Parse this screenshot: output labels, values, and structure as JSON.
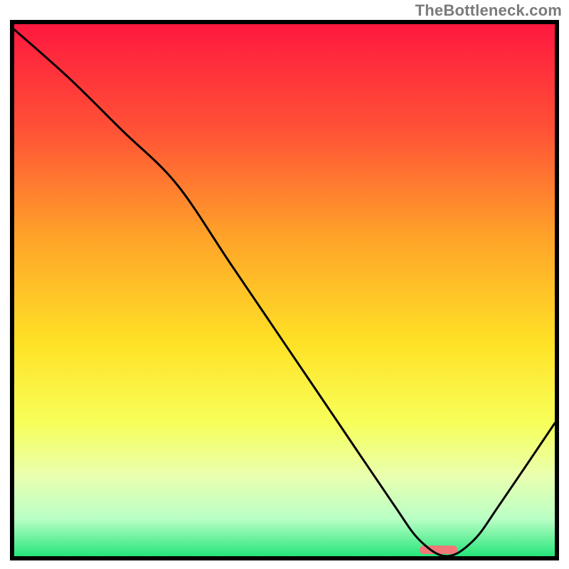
{
  "watermark": "TheBottleneck.com",
  "chart_data": {
    "type": "line",
    "title": "",
    "xlabel": "",
    "ylabel": "",
    "xlim": [
      0,
      100
    ],
    "ylim": [
      0,
      100
    ],
    "series": [
      {
        "name": "curve",
        "x": [
          0,
          10,
          20,
          30,
          40,
          50,
          60,
          70,
          75,
          80,
          85,
          90,
          100
        ],
        "values": [
          99,
          90,
          80,
          70,
          55,
          40,
          25,
          10,
          3,
          0,
          3,
          10,
          25
        ]
      }
    ],
    "marker": {
      "x_start": 75,
      "x_end": 82,
      "y": 1.2,
      "color": "#f07878"
    },
    "gradient_stops": [
      {
        "offset": 0.0,
        "color": "#ff183f"
      },
      {
        "offset": 0.2,
        "color": "#ff5236"
      },
      {
        "offset": 0.4,
        "color": "#ffa329"
      },
      {
        "offset": 0.6,
        "color": "#ffe226"
      },
      {
        "offset": 0.75,
        "color": "#f7ff5a"
      },
      {
        "offset": 0.85,
        "color": "#e9ffb0"
      },
      {
        "offset": 0.93,
        "color": "#b9ffc5"
      },
      {
        "offset": 1.0,
        "color": "#26e57a"
      }
    ],
    "grid": false,
    "legend": false
  }
}
